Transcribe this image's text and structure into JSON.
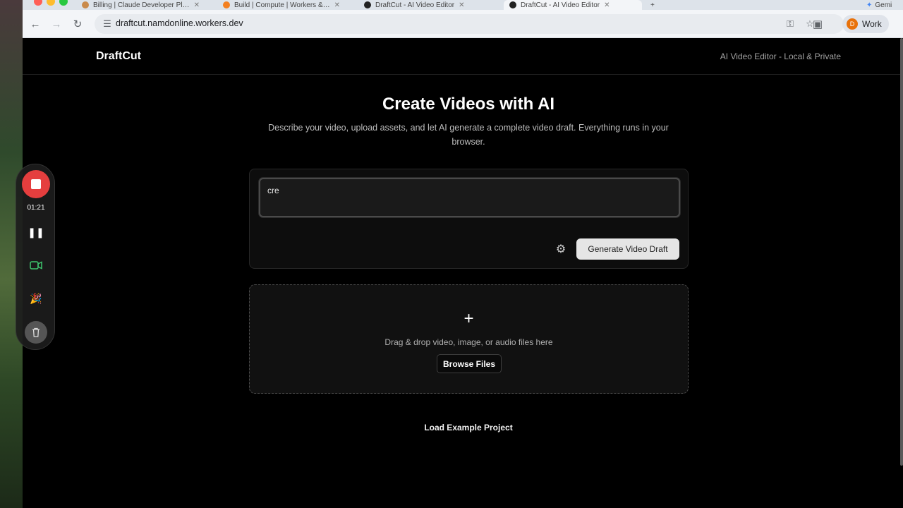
{
  "browser": {
    "tabs": [
      {
        "label": "Billing | Claude Developer Pl…",
        "fav": "#c98a4b"
      },
      {
        "label": "Build | Compute | Workers &…",
        "fav": "#f38020"
      },
      {
        "label": "DraftCut - AI Video Editor",
        "fav": "#222222"
      },
      {
        "label": "DraftCut - AI Video Editor",
        "fav": "#222222"
      }
    ],
    "url": "draftcut.namdonline.workers.dev",
    "profile_initial": "D",
    "profile_label": "Work",
    "corner_label": "Gemi"
  },
  "nav": {
    "brand": "DraftCut",
    "tagline": "AI Video Editor - Local & Private"
  },
  "hero": {
    "title": "Create Videos with AI",
    "subtitle": "Describe your video, upload assets, and let AI generate a complete video draft. Everything runs in your browser."
  },
  "prompt": {
    "value": "cre"
  },
  "actions": {
    "generate_label": "Generate Video Draft"
  },
  "dropzone": {
    "text": "Drag & drop video, image, or audio files here",
    "browse_label": "Browse Files"
  },
  "footer": {
    "example_label": "Load Example Project"
  },
  "recorder": {
    "time": "01:21"
  },
  "colors": {
    "record_red": "#e53e3e",
    "camera_green": "#3ec46d",
    "accent_pink": "#e05599"
  }
}
